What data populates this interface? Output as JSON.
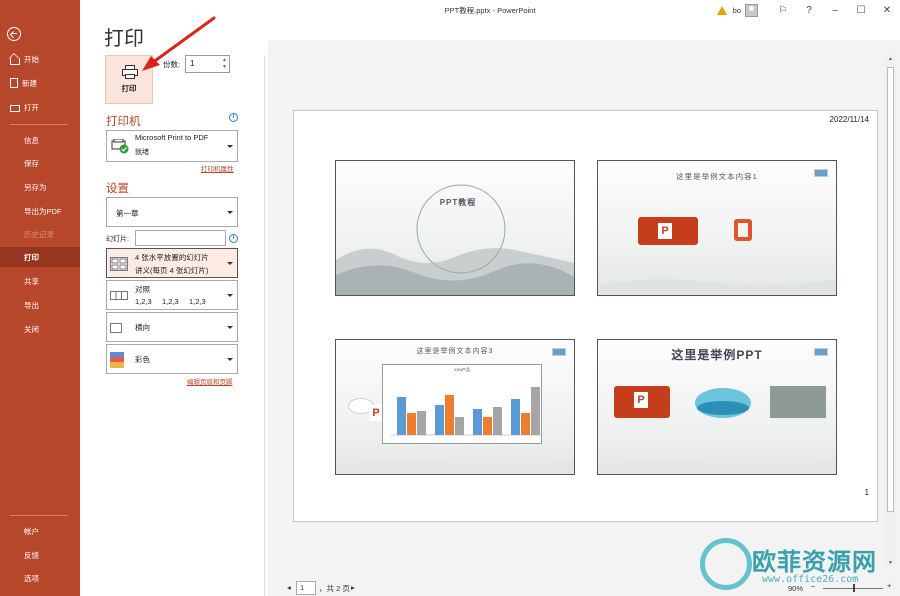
{
  "window": {
    "title": "PPT教程.pptx  -  PowerPoint",
    "user": "bo"
  },
  "sidebar": {
    "items": [
      {
        "label": "开始"
      },
      {
        "label": "新建"
      },
      {
        "label": "打开"
      },
      {
        "label": "信息"
      },
      {
        "label": "保存"
      },
      {
        "label": "另存为"
      },
      {
        "label": "导出为PDF"
      },
      {
        "label": "历史记录"
      },
      {
        "label": "打印"
      },
      {
        "label": "共享"
      },
      {
        "label": "导出"
      },
      {
        "label": "关闭"
      },
      {
        "label": "帐户"
      },
      {
        "label": "反馈"
      },
      {
        "label": "选项"
      }
    ]
  },
  "print": {
    "title": "打印",
    "button_label": "打印",
    "copies_label": "份数:",
    "copies_value": "1",
    "printer_heading": "打印机",
    "printer_name": "Microsoft Print to PDF",
    "printer_status": "就绪",
    "printer_properties": "打印机属性",
    "settings_heading": "设置",
    "range_value": "第一章",
    "slides_label": "幻灯片:",
    "slides_value": "",
    "layout_line1": "4 张水平放置的幻灯片",
    "layout_line2": "讲义(每页 4 张幻灯片)",
    "collate_title": "对照",
    "collate_seq": [
      "1,2,3",
      "1,2,3",
      "1,2,3"
    ],
    "orientation_value": "横向",
    "color_value": "彩色",
    "edit_header_footer": "编辑页眉和页脚"
  },
  "preview": {
    "date": "2022/11/14",
    "page_number": "1",
    "slides": [
      {
        "title": "PPT教程"
      },
      {
        "title": "这里是举例文本内容1"
      },
      {
        "title": "这里是举例文本内容3",
        "chart_title": "XXX产品"
      },
      {
        "title": "这里是举例PPT"
      }
    ]
  },
  "bottombar": {
    "current_page": "1",
    "total_pages": "，共 2 页",
    "zoom": "90%"
  },
  "watermark": {
    "title": "欧菲资源网",
    "url": "www.office26.com"
  },
  "colors": {
    "accent": "#b7472a",
    "sidebar_active": "#96361f"
  }
}
